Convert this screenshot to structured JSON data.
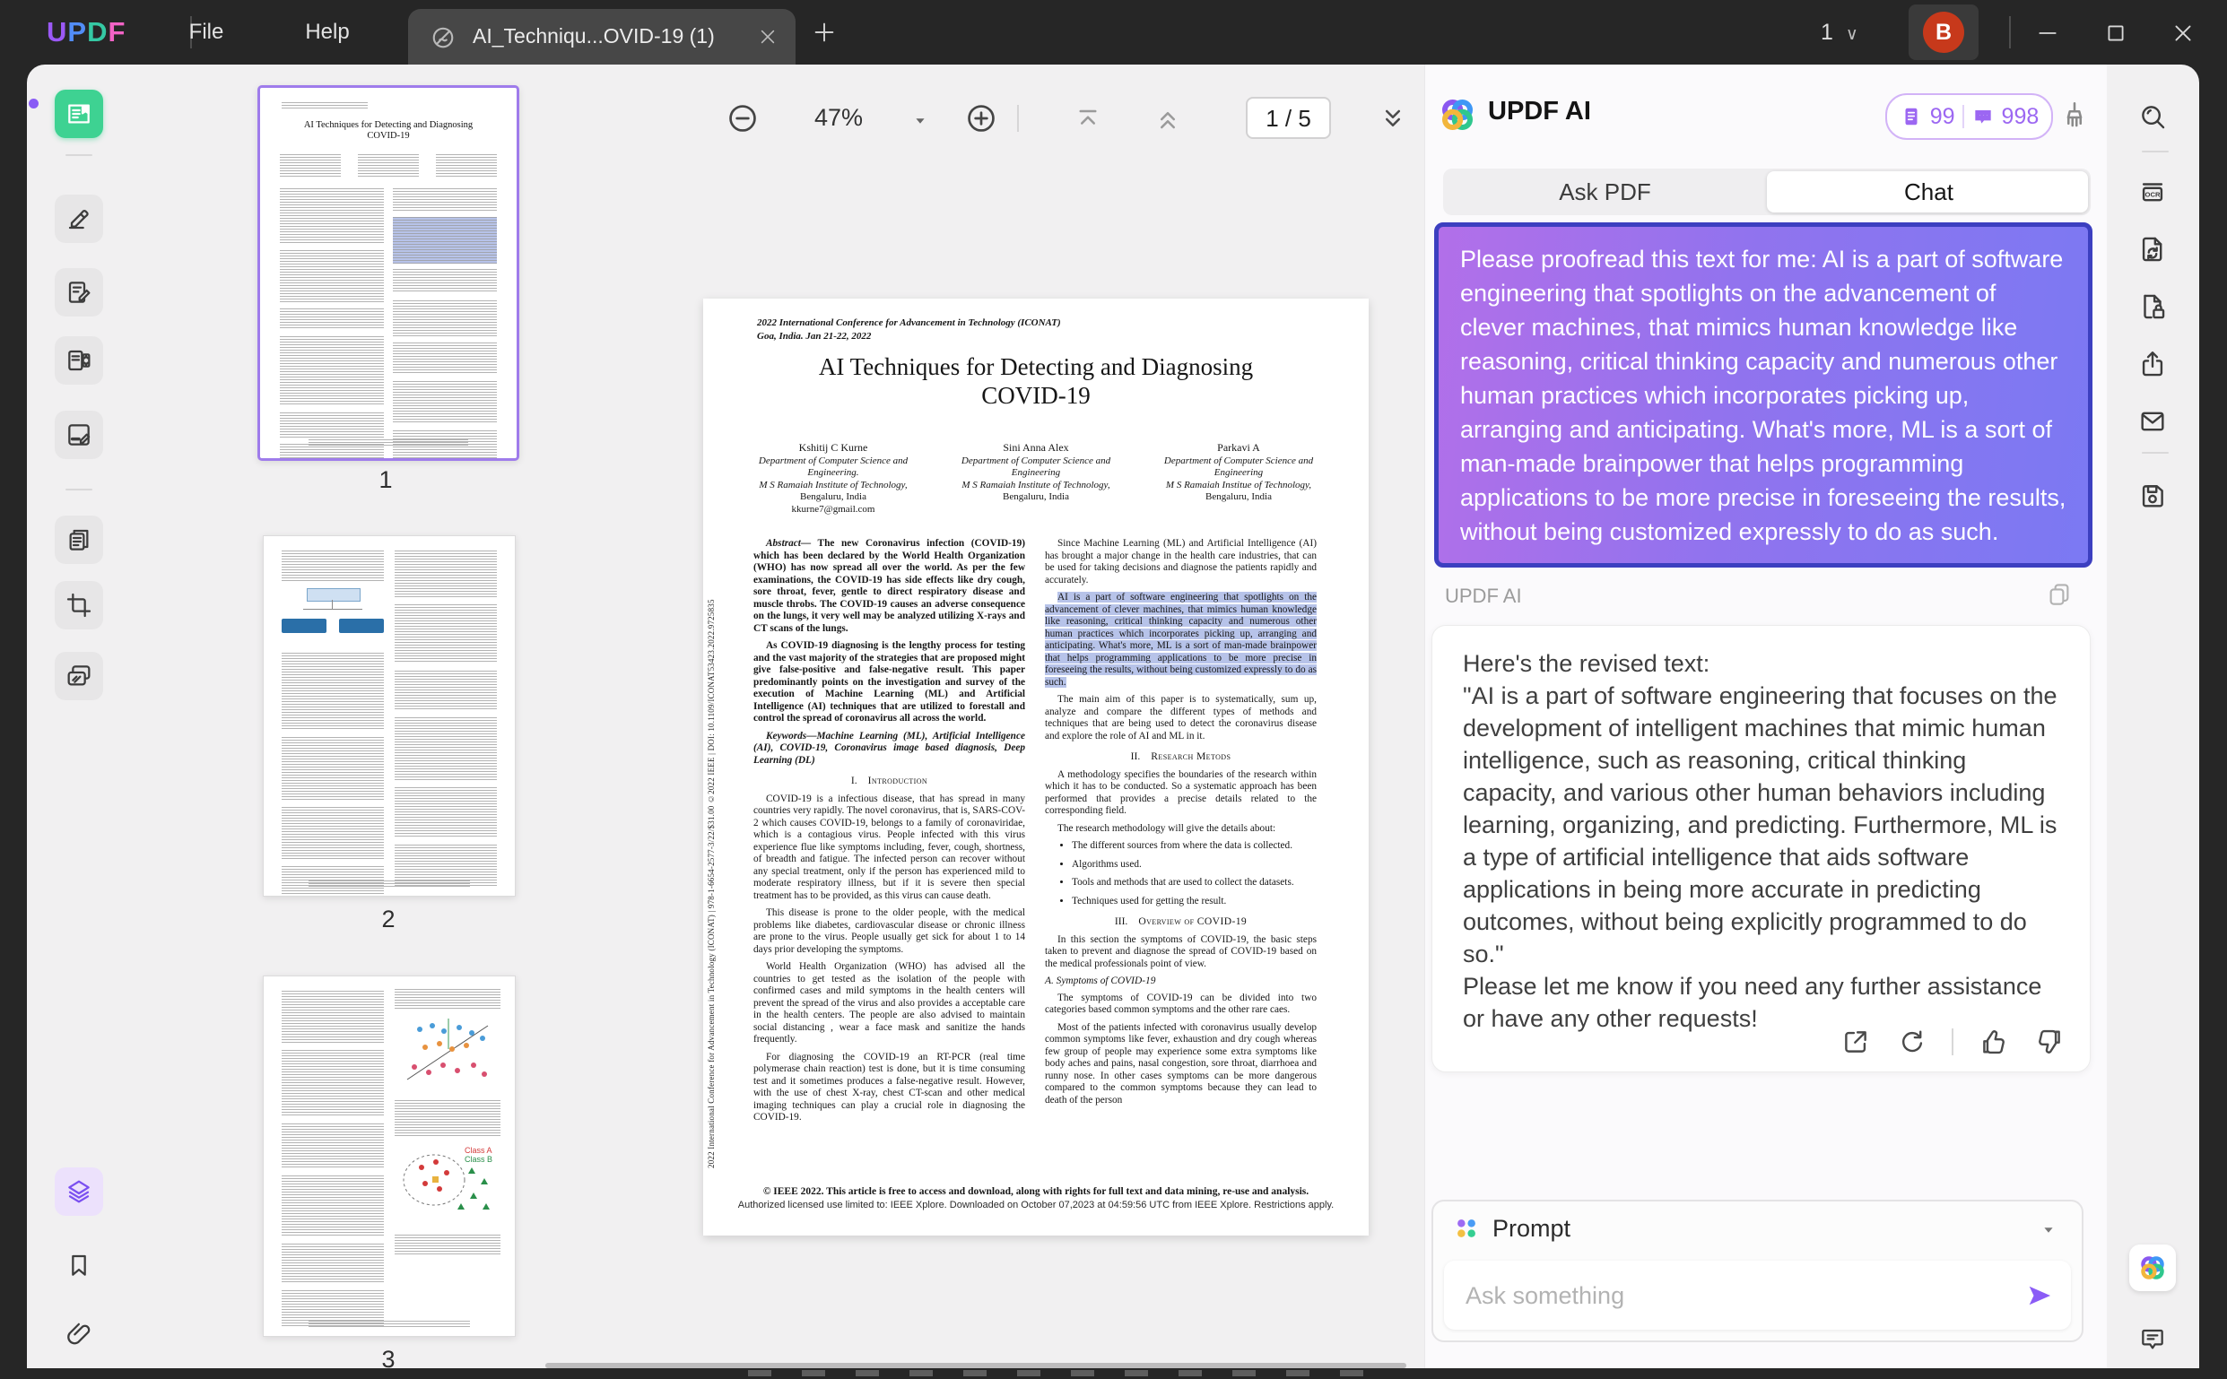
{
  "titlebar": {
    "app_logo": "UPDF",
    "menus": [
      "File",
      "Help"
    ],
    "tab_title": "AI_Techniqu...OVID-19 (1)",
    "window_count": "1",
    "avatar_initial": "B",
    "accent_colors": {
      "logo_u": "#9b59f6",
      "logo_p": "#528df7",
      "logo_d": "#35c9a4",
      "logo_f": "#f263c6"
    }
  },
  "left_toolbar": {
    "items": [
      "reader-icon",
      "divider",
      "highlighter-icon",
      "edit-icon",
      "organize-pages-icon",
      "fill-sign-icon",
      "divider",
      "page-tools-icon",
      "crop-icon",
      "screenshot-icon"
    ],
    "bottom_items": [
      "layers-icon",
      "bookmark-icon",
      "attachment-icon"
    ]
  },
  "right_toolbar": {
    "items": [
      "search-icon",
      "divider",
      "ocr-icon",
      "convert-icon",
      "protect-icon",
      "share-icon",
      "email-icon",
      "divider",
      "save-icon"
    ],
    "bottom_items": [
      "updf-ai-logo",
      "comment-icon"
    ]
  },
  "thumbnails": {
    "pages": [
      "1",
      "2",
      "3"
    ],
    "selected": "1",
    "fig_labels": [
      "Class A",
      "Class B"
    ]
  },
  "viewer_toolbar": {
    "zoom_level": "47%",
    "page_indicator": "1 / 5"
  },
  "pdf": {
    "conference_line1": "2022 International Conference for Advancement in Technology (ICONAT)",
    "conference_line2": "Goa, India. Jan 21-22, 2022",
    "title_line1": "AI Techniques for Detecting and Diagnosing",
    "title_line2": "COVID-19",
    "authors": [
      {
        "name": "Kshitij C Kurne",
        "lines": [
          "Department of Computer Science and",
          "Engineering.",
          "M S Ramaiah Institute of Technology,"
        ],
        "city": "Bengaluru, India",
        "email": "kkurne7@gmail.com"
      },
      {
        "name": "Sini Anna Alex",
        "lines": [
          "Department of Computer Science and",
          "Engineering",
          "M S Ramaiah Institute of Technology,"
        ],
        "city": "Bengaluru, India",
        "email": ""
      },
      {
        "name": "Parkavi A",
        "lines": [
          "Department of Computer Science and",
          "Engineering",
          "M S Ramaiah Institue of Technology,"
        ],
        "city": "Bengaluru, India",
        "email": ""
      }
    ],
    "side_text": "2022 International Conference for Advancement in Technology (ICONAT) | 978-1-6654-2577-3/22/$31.00 ©2022 IEEE | DOI: 10.1109/ICONAT53423.2022.9725835",
    "left_column": [
      {
        "t": "p",
        "s": "bold",
        "lead": "Abstract—",
        "text": " The new Coronavirus infection (COVID-19) which has been declared by the World Health Organization (WHO) has now spread all over the world. As per the few examinations, the COVID-19 has side effects like dry cough, sore throat, fever, gentle to direct respiratory disease and muscle throbs. The COVID-19 causes an adverse consequence on the lungs, it very well may be analyzed utilizing X-rays and CT scans of the lungs."
      },
      {
        "t": "p",
        "s": "bold",
        "text": "As COVID-19 diagnosing is the lengthy process for testing and the vast majority of the strategies that are proposed might give false-positive and false-negative result. This paper predominantly points on the investigation and survey of the execution of Machine Learning (ML) and Artificial Intelligence (AI) techniques that are utilized to forestall and control the spread of coronavirus all across the world."
      },
      {
        "t": "p",
        "s": "kw",
        "text": "Keywords—Machine Learning (ML), Artificial Intelligence (AI), COVID-19, Coronavirus image based diagnosis, Deep Learning (DL)"
      },
      {
        "t": "h",
        "num": "I.",
        "text": "Introduction"
      },
      {
        "t": "p",
        "text": "COVID-19 is a infectious disease, that has spread in many countries very rapidly. The novel coronavirus, that is, SARS-COV-2 which causes COVID-19, belongs to a family of coronaviridae, which is a contagious virus. People infected with this virus experience flue like symptoms including, fever, cough, shortness, of breadth and fatigue. The infected person can recover without any special treatment, only if the person has experienced mild to moderate respiratory illness, but if it is severe then special treatment has to be provided, as this virus can cause death."
      },
      {
        "t": "p",
        "text": "This disease is prone to the older people, with the medical problems like diabetes, cardiovascular disease or chronic illness are prone to the virus. People usually get sick for about 1 to 14 days prior developing the symptoms."
      },
      {
        "t": "p",
        "text": "World Health Organization (WHO) has advised all the countries to get tested as the isolation of the people with confirmed cases and mild symptoms in the health centers will prevent the spread of the virus and also provides a acceptable care in the health centers. The people are also advised to maintain social distancing , wear a face mask and sanitize the hands frequently."
      },
      {
        "t": "p",
        "text": "For diagnosing the COVID-19 an RT-PCR (real time polymerase chain reaction) test is done, but it is time consuming test and it sometimes produces a false-negative result. However, with the use of chest X-ray, chest CT-scan and other medical imaging techniques can play a crucial role in diagnosing the COVID-19."
      }
    ],
    "right_column": [
      {
        "t": "p",
        "text": "Since Machine Learning (ML) and Artificial Intelligence (AI) has brought a major change in the health care industries, that can be used for taking decisions and diagnose the patients rapidly and accurately."
      },
      {
        "t": "p",
        "highlight": true,
        "text": "AI is a part of software engineering that spotlights on the advancement of clever machines, that mimics human knowledge like reasoning, critical thinking capacity and numerous other human practices which incorporates picking up, arranging and anticipating. What's more, ML is a sort of man-made brainpower that helps programming applications to be more precise in foreseeing the results, without being customized expressly to do as such."
      },
      {
        "t": "p",
        "text": "The main aim of this paper is to systematically, sum up, analyze and compare the different types of methods and techniques that are being used to detect the coronavirus disease and explore the role of AI and ML in it."
      },
      {
        "t": "h",
        "num": "II.",
        "text": "Research Metods"
      },
      {
        "t": "p",
        "text": "A methodology specifies the boundaries of the research within which it has to be conducted. So a systematic approach has been performed that provides a precise details related to the corresponding field."
      },
      {
        "t": "p",
        "text": "The research methodology will give the details about:"
      },
      {
        "t": "ul",
        "items": [
          "The different sources from where the data is collected.",
          "Algorithms used.",
          "Tools and methods that are used to collect the datasets.",
          "Techniques used for getting the result."
        ]
      },
      {
        "t": "h",
        "num": "III.",
        "text": "Overview of COVID-19"
      },
      {
        "t": "p",
        "text": "In this section the symptoms of COVID-19, the basic steps taken to prevent and diagnose the spread of COVID-19 based on the medical professionals point of view."
      },
      {
        "t": "sub",
        "text": "A.   Symptoms of COVID-19"
      },
      {
        "t": "p",
        "text": "The symptoms of COVID-19 can be divided into two categories based common symptoms and the other rare caes."
      },
      {
        "t": "p",
        "text": "Most of the patients infected with coronavirus usually develop common symptoms like fever, exhaustion and dry cough whereas few group of people may experience some extra symptoms like body aches and pains, nasal congestion, sore throat, diarrhoea and runny nose. In other cases symptoms can be more dangerous compared to the common symptoms because they can lead to death of the person"
      }
    ],
    "footer_line1": "© IEEE 2022. This article is free to access and download, along with rights for full text and data mining, re-use and analysis.",
    "footer_line2": "Authorized licensed use limited to: IEEE Xplore. Downloaded on October 07,2023 at 04:59:56 UTC from IEEE Xplore.  Restrictions apply."
  },
  "ai": {
    "title": "UPDF AI",
    "credits": {
      "pdf_count": "99",
      "chat_count": "998"
    },
    "tabs": {
      "ask_pdf": "Ask PDF",
      "chat": "Chat"
    },
    "active_tab": "Chat",
    "user_message": "Please proofread this text for me: AI is a part of software engineering that spotlights on the advancement of clever machines, that mimics human knowledge like reasoning, critical thinking capacity and numerous other human practices which incorporates picking up, arranging and anticipating. What's more, ML is a sort of man-made brainpower that helps programming applications to be more precise in foreseeing the results, without being customized expressly to do as such.",
    "response_label": "UPDF AI",
    "response_paragraphs": [
      "Here's the revised text:",
      "\"AI is a part of software engineering that focuses on the development of intelligent machines that mimic human intelligence, such as reasoning, critical thinking capacity, and various other human behaviors including learning, organizing, and predicting. Furthermore, ML is a type of artificial intelligence that aids software applications in being more accurate in predicting outcomes, without being explicitly programmed to do so.\"",
      "Please let me know if you need any further assistance or have any other requests!"
    ],
    "prompt_label": "Prompt",
    "input_placeholder": "Ask something",
    "accent": "#8b5cf6"
  }
}
